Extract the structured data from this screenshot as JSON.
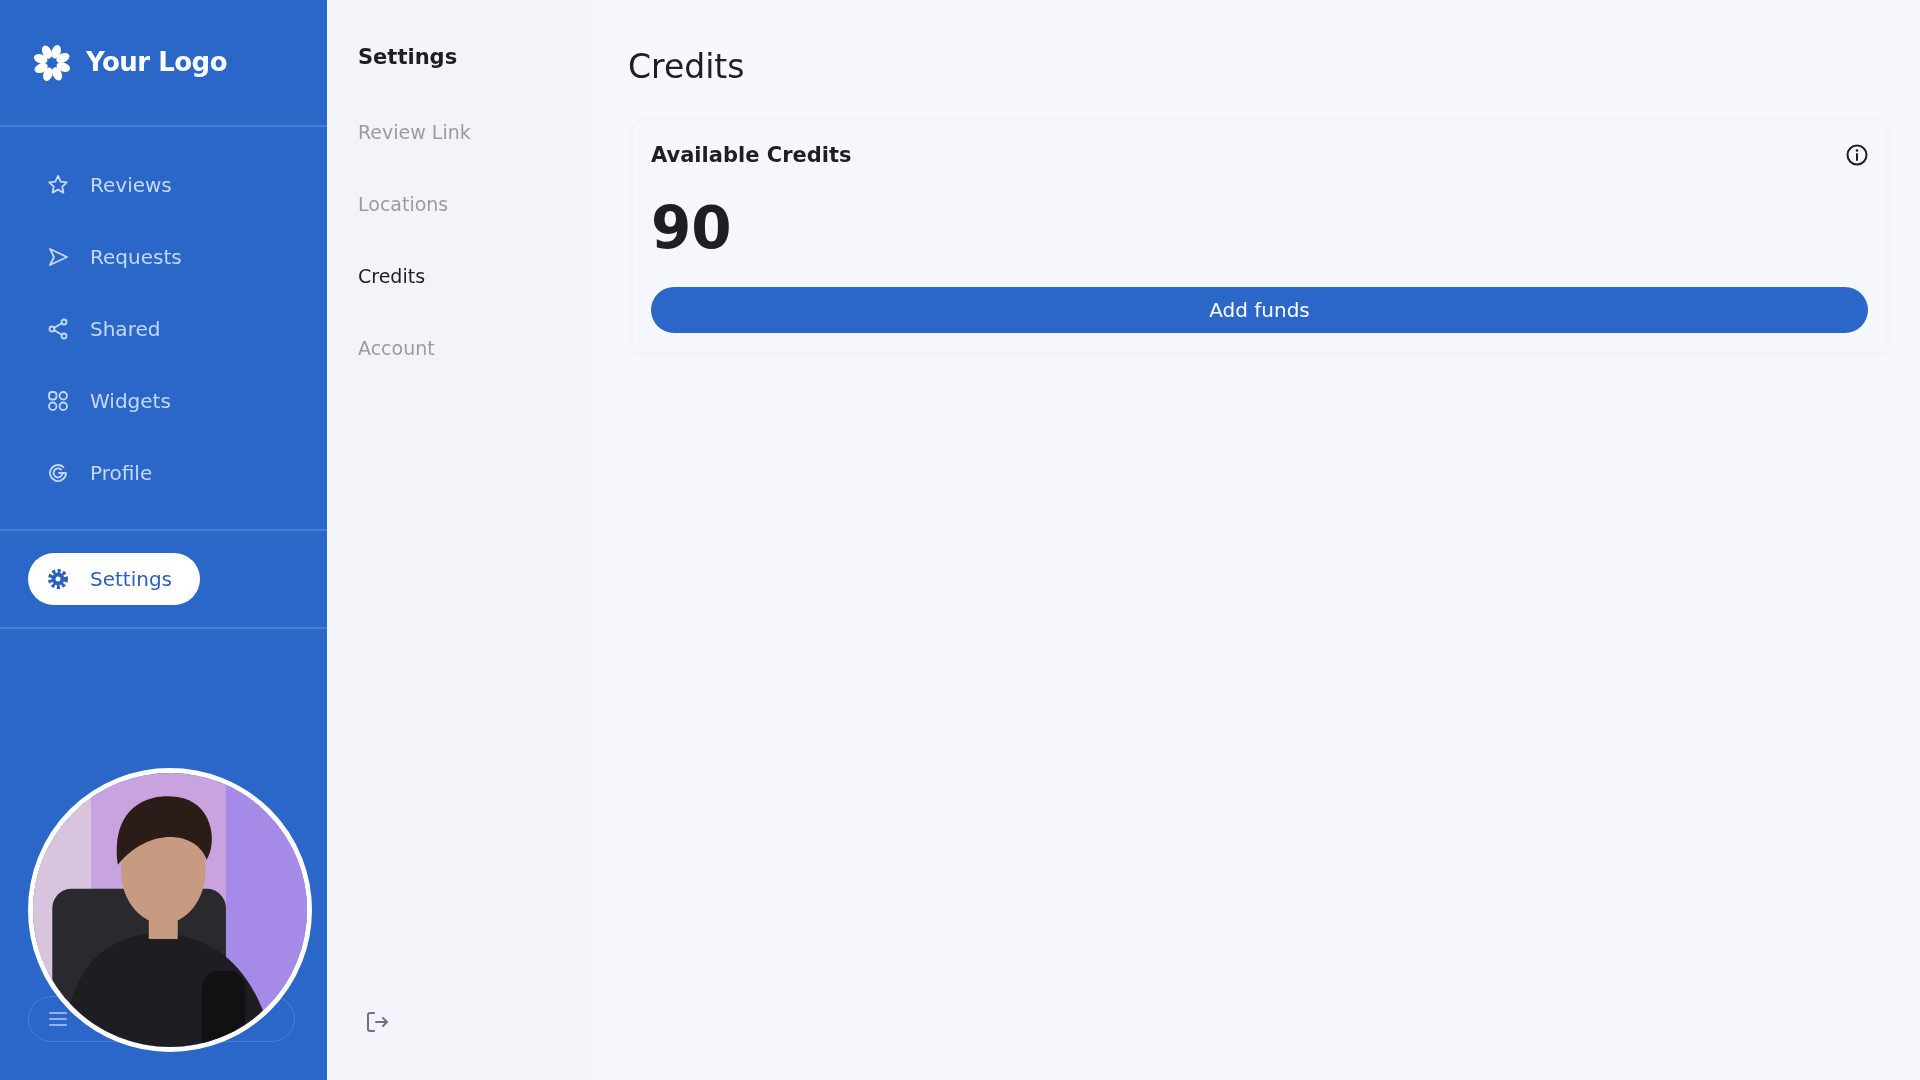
{
  "sidebar": {
    "logo": "Your Logo",
    "items": [
      {
        "label": "Reviews",
        "selected": false
      },
      {
        "label": "Requests",
        "selected": false
      },
      {
        "label": "Shared",
        "selected": false
      },
      {
        "label": "Widgets",
        "selected": false
      },
      {
        "label": "Profile",
        "selected": false
      }
    ],
    "bottom_items": [
      {
        "label": "Settings",
        "selected": true
      }
    ]
  },
  "settings_menu": {
    "title": "Settings",
    "items": [
      {
        "label": "Review Link",
        "selected": false
      },
      {
        "label": "Locations",
        "selected": false
      },
      {
        "label": "Credits",
        "selected": true
      },
      {
        "label": "Account",
        "selected": false
      }
    ]
  },
  "main": {
    "title": "Credits",
    "card": {
      "title": "Available Credits",
      "value": "90",
      "button": "Add funds"
    }
  }
}
